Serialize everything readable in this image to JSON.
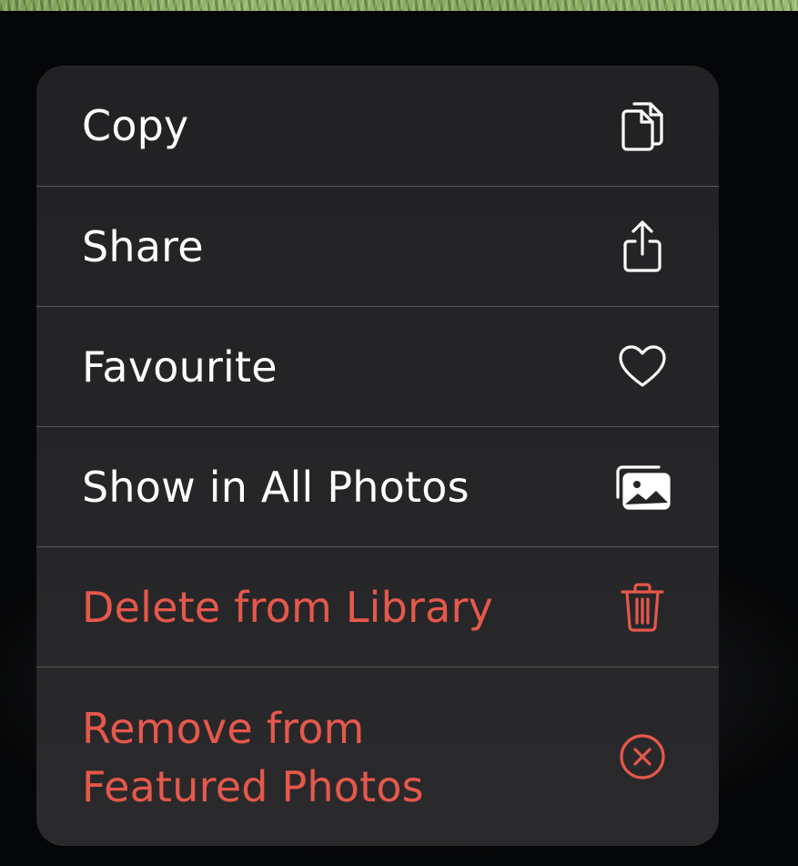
{
  "background": {
    "photo_strip_color": "#8fb266",
    "backdrop_color": "#050607"
  },
  "context_menu": {
    "items": [
      {
        "label": "Copy",
        "icon": "copy-icon",
        "destructive": false
      },
      {
        "label": "Share",
        "icon": "share-icon",
        "destructive": false
      },
      {
        "label": "Favourite",
        "icon": "heart-icon",
        "destructive": false
      },
      {
        "label": "Show in All Photos",
        "icon": "photos-icon",
        "destructive": false
      },
      {
        "label": "Delete from Library",
        "icon": "trash-icon",
        "destructive": true
      },
      {
        "label": "Remove from\nFeatured Photos",
        "icon": "remove-circle-icon",
        "destructive": true
      }
    ],
    "colors": {
      "menu_background": "#252527",
      "label": "#ffffff",
      "destructive": "#e5584b",
      "separator": "#56565a"
    }
  }
}
